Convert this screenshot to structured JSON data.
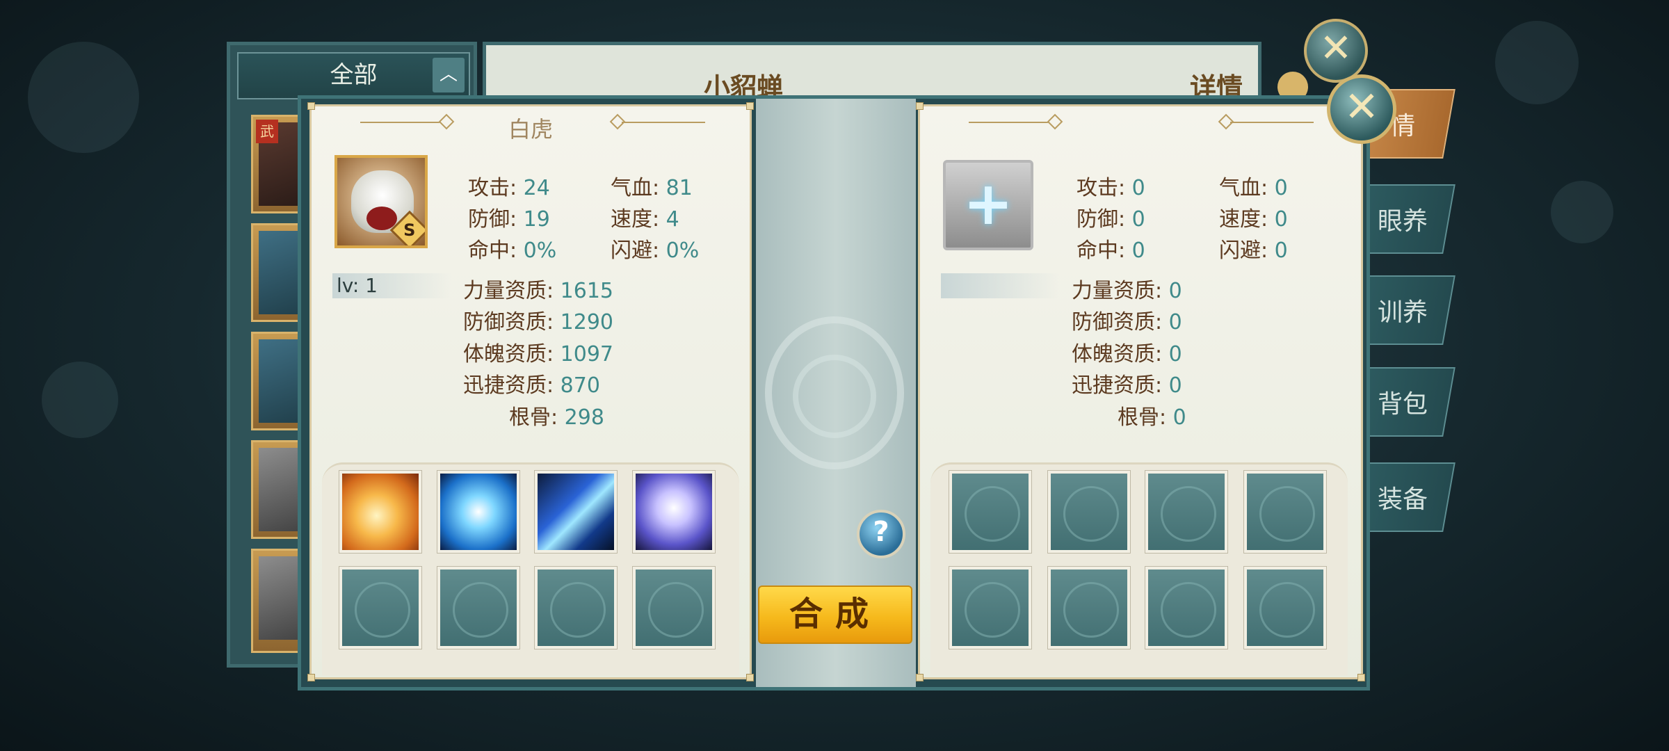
{
  "background_window": {
    "filter_label": "全部",
    "pet_name": "小貂蝉",
    "detail_title": "详情",
    "card_tag": "武",
    "tabs": [
      "情",
      "眼养",
      "训养",
      "背包",
      "装备"
    ]
  },
  "left_panel": {
    "title": "白虎",
    "grade": "S",
    "level": "lv: 1",
    "stats": {
      "attack": {
        "label": "攻击:",
        "value": "24"
      },
      "hp": {
        "label": "气血:",
        "value": "81"
      },
      "defense": {
        "label": "防御:",
        "value": "19"
      },
      "speed": {
        "label": "速度:",
        "value": "4"
      },
      "hit": {
        "label": "命中:",
        "value": "0%"
      },
      "dodge": {
        "label": "闪避:",
        "value": "0%"
      }
    },
    "aptitudes": [
      {
        "label": "力量资质:",
        "value": "1615"
      },
      {
        "label": "防御资质:",
        "value": "1290"
      },
      {
        "label": "体魄资质:",
        "value": "1097"
      },
      {
        "label": "迅捷资质:",
        "value": "870"
      },
      {
        "label": "根骨:",
        "value": "298"
      }
    ],
    "skills": [
      "flame-beast-skill-icon",
      "blue-heart-skill-icon",
      "ice-shard-skill-icon",
      "spirit-orb-skill-icon"
    ]
  },
  "right_panel": {
    "stats": {
      "attack": {
        "label": "攻击:",
        "value": "0"
      },
      "hp": {
        "label": "气血:",
        "value": "0"
      },
      "defense": {
        "label": "防御:",
        "value": "0"
      },
      "speed": {
        "label": "速度:",
        "value": "0"
      },
      "hit": {
        "label": "命中:",
        "value": "0"
      },
      "dodge": {
        "label": "闪避:",
        "value": "0"
      }
    },
    "aptitudes": [
      {
        "label": "力量资质:",
        "value": "0"
      },
      {
        "label": "防御资质:",
        "value": "0"
      },
      {
        "label": "体魄资质:",
        "value": "0"
      },
      {
        "label": "迅捷资质:",
        "value": "0"
      },
      {
        "label": "根骨:",
        "value": "0"
      }
    ]
  },
  "actions": {
    "help": "?",
    "craft": "合成",
    "close": "✕",
    "add": "+"
  },
  "colors": {
    "stat_label": "#5c3a20",
    "stat_value": "#3f8a8a",
    "craft_button": "#f6b91c",
    "frame": "#264a50"
  }
}
